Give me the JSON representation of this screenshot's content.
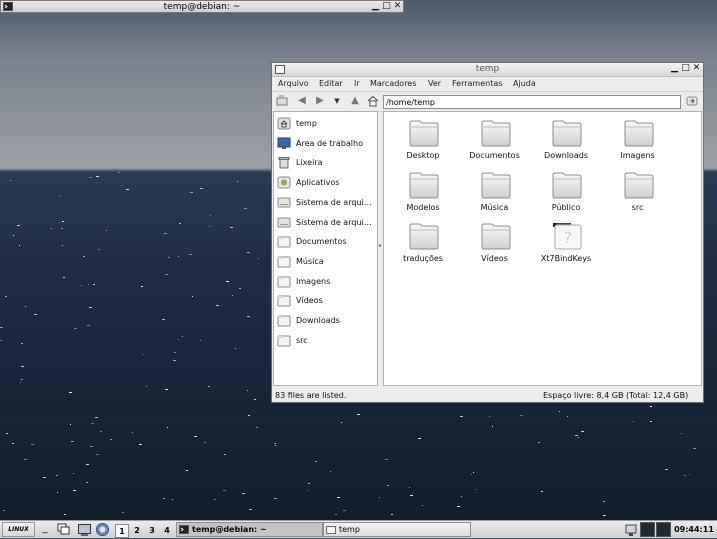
{
  "terminal_window": {
    "title": "temp@debian: ~"
  },
  "file_manager": {
    "title": "temp",
    "menu": [
      "Arquivo",
      "Editar",
      "Ir",
      "Marcadores",
      "Ver",
      "Ferramentas",
      "Ajuda"
    ],
    "address": "/home/temp",
    "sidebar": [
      {
        "label": "temp",
        "icon": "home-icon"
      },
      {
        "label": "Área de trabalho",
        "icon": "desktop-icon"
      },
      {
        "label": "Lixeira",
        "icon": "trash-icon"
      },
      {
        "label": "Aplicativos",
        "icon": "applications-icon"
      },
      {
        "label": "Sistema de arqui…",
        "icon": "drive-icon"
      },
      {
        "label": "Sistema de arqui…",
        "icon": "drive-icon"
      },
      {
        "label": "Documentos",
        "icon": "folder-icon"
      },
      {
        "label": "Música",
        "icon": "folder-icon"
      },
      {
        "label": "Imagens",
        "icon": "folder-icon"
      },
      {
        "label": "Vídeos",
        "icon": "folder-icon"
      },
      {
        "label": "Downloads",
        "icon": "folder-icon"
      },
      {
        "label": "src",
        "icon": "folder-icon"
      }
    ],
    "files": [
      {
        "name": "Desktop",
        "icon": "folder-icon"
      },
      {
        "name": "Documentos",
        "icon": "folder-icon"
      },
      {
        "name": "Downloads",
        "icon": "folder-icon"
      },
      {
        "name": "Imagens",
        "icon": "folder-icon"
      },
      {
        "name": "Modelos",
        "icon": "folder-icon"
      },
      {
        "name": "Música",
        "icon": "folder-icon"
      },
      {
        "name": "Público",
        "icon": "folder-icon"
      },
      {
        "name": "src",
        "icon": "folder-icon"
      },
      {
        "name": "traduções",
        "icon": "folder-icon"
      },
      {
        "name": "Vídeos",
        "icon": "folder-icon"
      },
      {
        "name": "Xt7BindKeys",
        "icon": "unknown-file-icon"
      }
    ],
    "status_left": "83 files are listed.",
    "status_right": "Espaço livre: 8,4 GB (Total: 12,4 GB)"
  },
  "taskbar": {
    "menu_label": "LINUX",
    "desktops": [
      "1",
      "2",
      "3",
      "4"
    ],
    "tasks": [
      {
        "label": "temp@debian: ~",
        "icon": "terminal-icon"
      },
      {
        "label": "temp",
        "icon": "folder-icon"
      }
    ],
    "clock": "09:44:11"
  }
}
